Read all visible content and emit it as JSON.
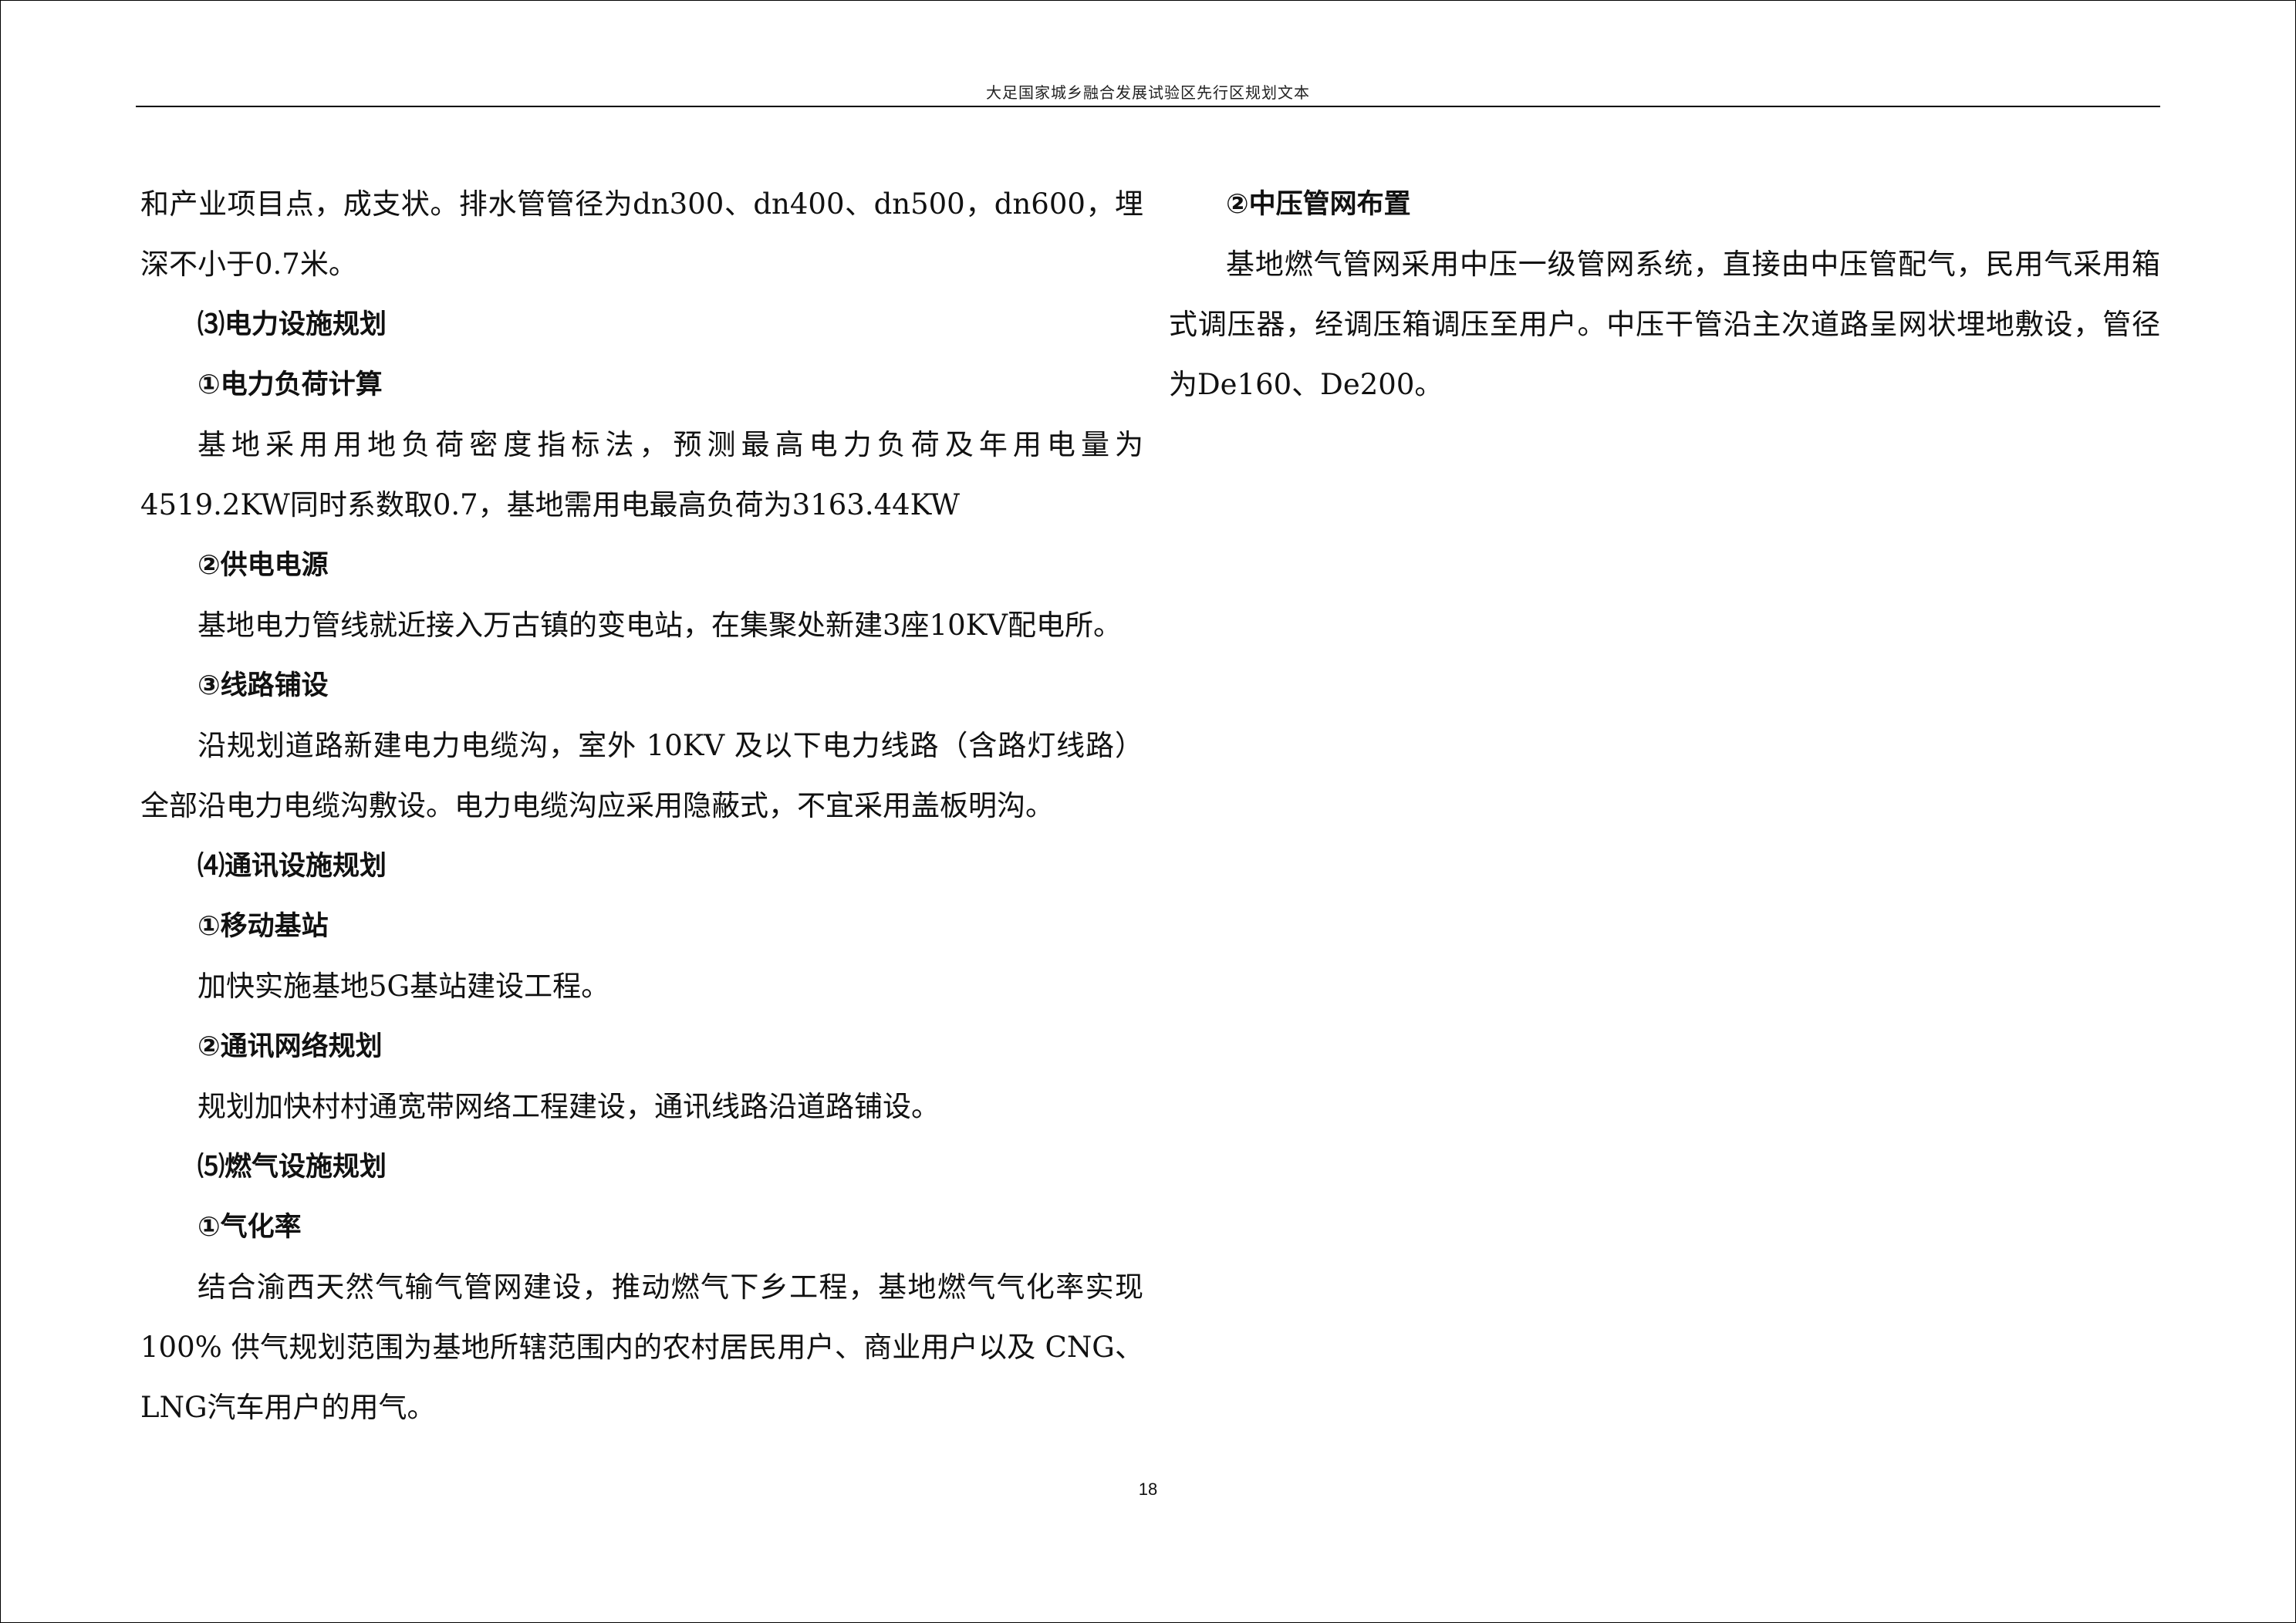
{
  "header": {
    "title": "大足国家城乡融合发展试验区先行区规划文本"
  },
  "left_column": [
    {
      "kind": "para",
      "indent": false,
      "text": "和产业项目点，成支状。排水管管径为dn300、dn400、dn500，dn600，埋深不小于0.7米。"
    },
    {
      "kind": "heading",
      "text": "⑶电力设施规划"
    },
    {
      "kind": "heading",
      "text": "①电力负荷计算"
    },
    {
      "kind": "para",
      "indent": true,
      "text": "基地采用用地负荷密度指标法，预测最高电力负荷及年用电量为4519.2KW同时系数取0.7，基地需用电最高负荷为3163.44KW"
    },
    {
      "kind": "heading",
      "text": "②供电电源"
    },
    {
      "kind": "para",
      "indent": true,
      "text": "基地电力管线就近接入万古镇的变电站，在集聚处新建3座10KV配电所。"
    },
    {
      "kind": "heading",
      "text": "③线路铺设"
    },
    {
      "kind": "para",
      "indent": true,
      "text": "沿规划道路新建电力电缆沟，室外 10KV 及以下电力线路（含路灯线路）全部沿电力电缆沟敷设。电力电缆沟应采用隐蔽式，不宜采用盖板明沟。"
    },
    {
      "kind": "heading",
      "text": "⑷通讯设施规划"
    },
    {
      "kind": "heading",
      "text": "①移动基站"
    },
    {
      "kind": "para",
      "indent": true,
      "text": "加快实施基地5G基站建设工程。"
    },
    {
      "kind": "heading",
      "text": "②通讯网络规划"
    },
    {
      "kind": "para",
      "indent": true,
      "text": "规划加快村村通宽带网络工程建设，通讯线路沿道路铺设。"
    },
    {
      "kind": "heading",
      "text": "⑸燃气设施规划"
    },
    {
      "kind": "heading",
      "text": "①气化率"
    },
    {
      "kind": "para",
      "indent": true,
      "text": "结合渝西天然气输气管网建设，推动燃气下乡工程，基地燃气气化率实现100% 供气规划范围为基地所辖范围内的农村居民用户、商业用户以及 CNG、LNG汽车用户的用气。"
    }
  ],
  "right_column": [
    {
      "kind": "heading",
      "text": "②中压管网布置"
    },
    {
      "kind": "para",
      "indent": true,
      "text": "基地燃气管网采用中压一级管网系统，直接由中压管配气，民用气采用箱式调压器，经调压箱调压至用户。中压干管沿主次道路呈网状埋地敷设，管径为De160、De200。"
    }
  ],
  "footer": {
    "page_number": "18"
  }
}
